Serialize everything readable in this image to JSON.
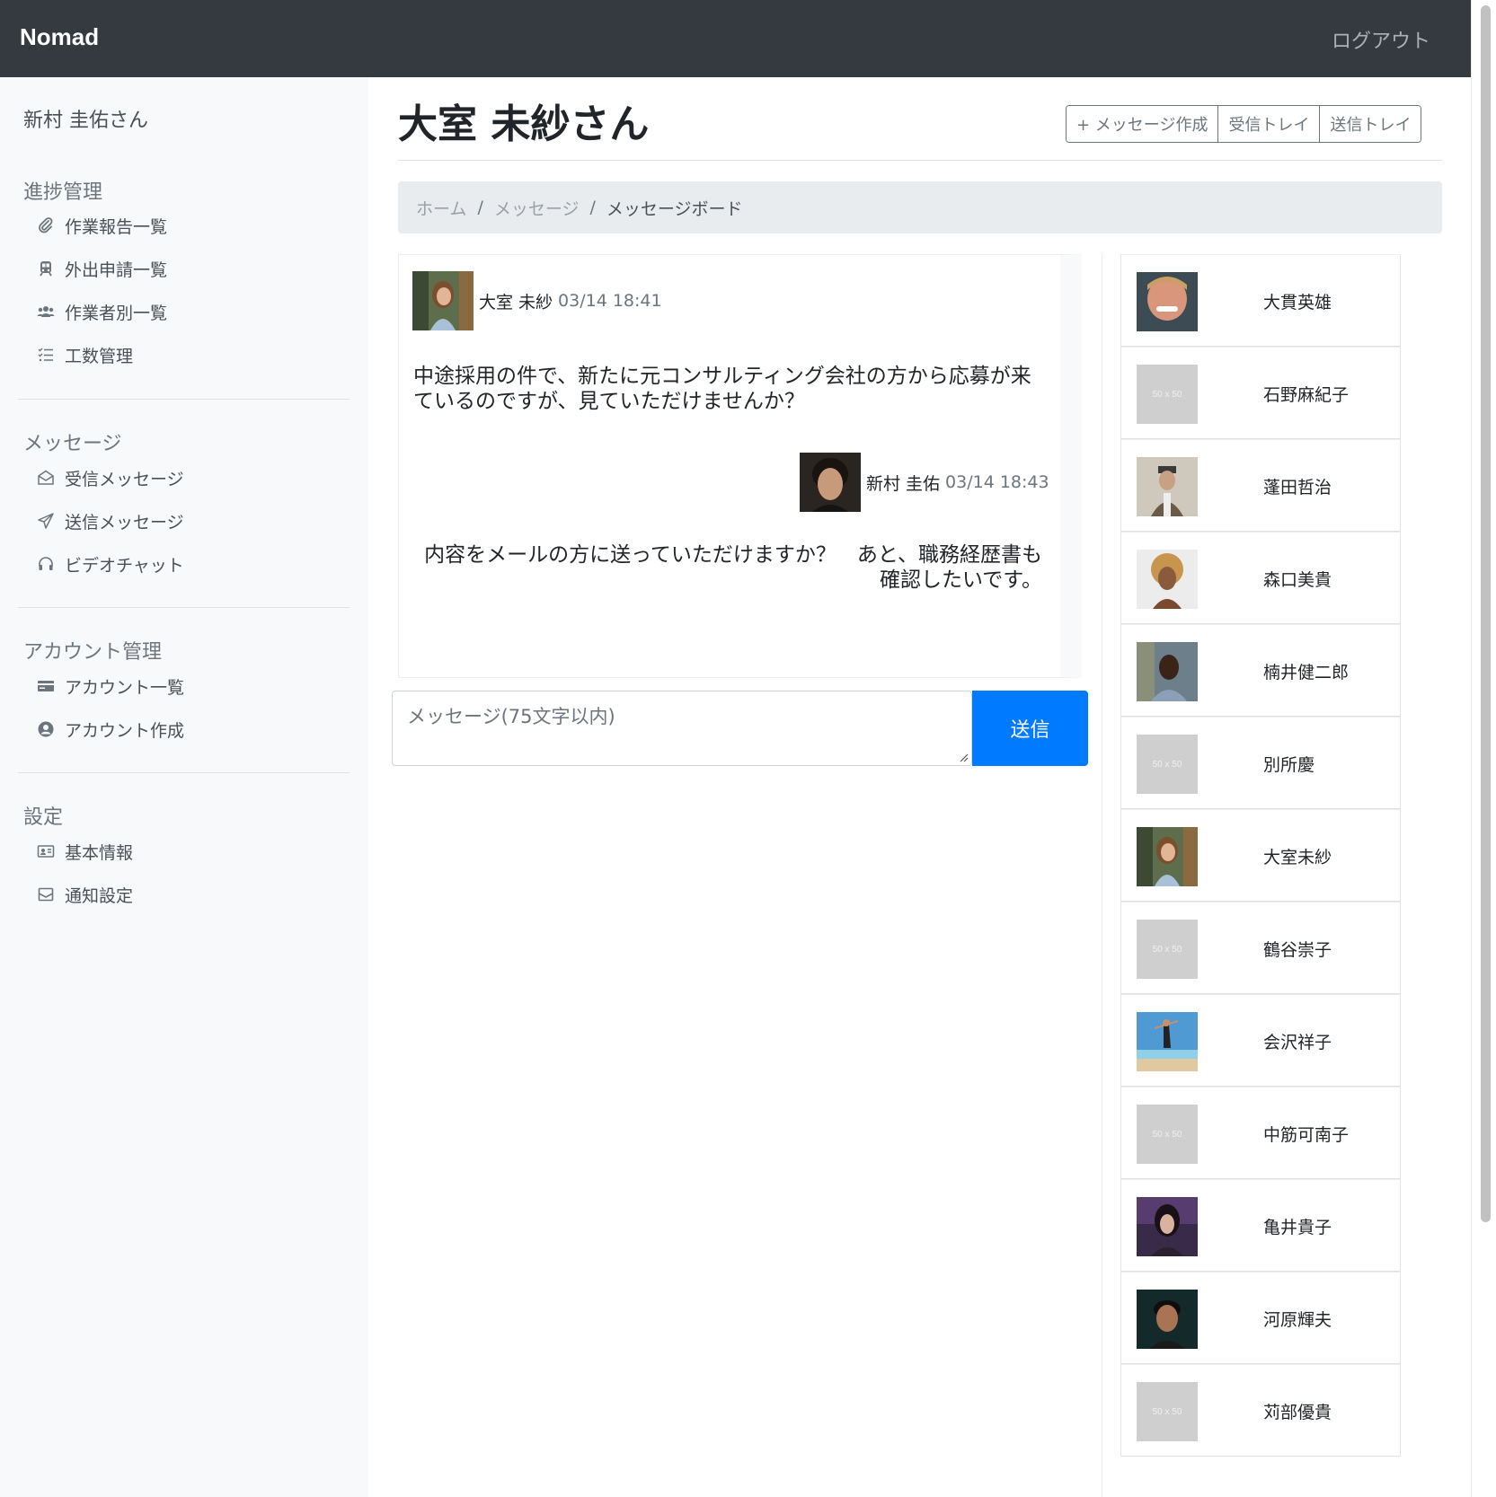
{
  "app": {
    "brand": "Nomad",
    "logout_label": "ログアウト"
  },
  "sidebar": {
    "user_name": "新村 圭佑さん",
    "sections": [
      {
        "title": "進捗管理",
        "items": [
          {
            "label": "作業報告一覧",
            "icon": "paperclip-icon"
          },
          {
            "label": "外出申請一覧",
            "icon": "train-icon"
          },
          {
            "label": "作業者別一覧",
            "icon": "users-icon"
          },
          {
            "label": "工数管理",
            "icon": "tasks-icon"
          }
        ]
      },
      {
        "title": "メッセージ",
        "items": [
          {
            "label": "受信メッセージ",
            "icon": "envelope-open-icon"
          },
          {
            "label": "送信メッセージ",
            "icon": "paper-plane-icon"
          },
          {
            "label": "ビデオチャット",
            "icon": "headphones-icon"
          }
        ]
      },
      {
        "title": "アカウント管理",
        "items": [
          {
            "label": "アカウント一覧",
            "icon": "id-card-icon"
          },
          {
            "label": "アカウント作成",
            "icon": "user-circle-icon"
          }
        ]
      },
      {
        "title": "設定",
        "items": [
          {
            "label": "基本情報",
            "icon": "address-card-icon"
          },
          {
            "label": "通知設定",
            "icon": "envelope-icon"
          }
        ]
      }
    ]
  },
  "header": {
    "title": "大室 未紗さん",
    "buttons": [
      "+ メッセージ作成",
      "受信トレイ",
      "送信トレイ"
    ]
  },
  "breadcrumb": {
    "home": "ホーム",
    "messages": "メッセージ",
    "current": "メッセージボード",
    "separator": "/"
  },
  "messages": [
    {
      "name": "大室 未紗",
      "time": "03/14 18:41",
      "body": "中途採用の件で、新たに元コンサルティング会社の方から応募が来ているのですが、見ていただけませんか？"
    },
    {
      "name": "新村 圭佑",
      "time": "03/14 18:43",
      "body": "内容をメールの方に送っていただけますか？　あと、職務経歴書も確認したいです。"
    }
  ],
  "composer": {
    "placeholder": "メッセージ(75文字以内)",
    "send_label": "送信"
  },
  "contacts": [
    {
      "name": "大貫英雄",
      "has_photo": true
    },
    {
      "name": "石野麻紀子",
      "has_photo": false,
      "placeholder": "50 x 50"
    },
    {
      "name": "蓬田哲治",
      "has_photo": true
    },
    {
      "name": "森口美貴",
      "has_photo": true
    },
    {
      "name": "楠井健二郎",
      "has_photo": true
    },
    {
      "name": "別所慶",
      "has_photo": false,
      "placeholder": "50 x 50"
    },
    {
      "name": "大室未紗",
      "has_photo": true
    },
    {
      "name": "鶴谷崇子",
      "has_photo": false,
      "placeholder": "50 x 50"
    },
    {
      "name": "会沢祥子",
      "has_photo": true
    },
    {
      "name": "中筋可南子",
      "has_photo": false,
      "placeholder": "50 x 50"
    },
    {
      "name": "亀井貴子",
      "has_photo": true
    },
    {
      "name": "河原輝夫",
      "has_photo": true
    },
    {
      "name": "苅部優貴",
      "has_photo": false,
      "placeholder": "50 x 50"
    }
  ]
}
